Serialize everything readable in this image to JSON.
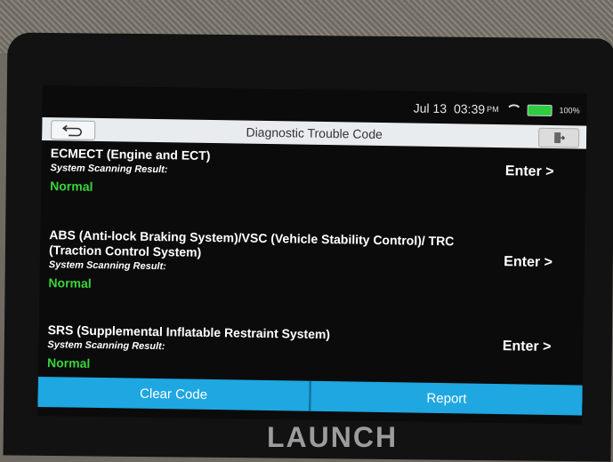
{
  "status": {
    "date": "Jul 13",
    "time": "03:39",
    "ampm": "PM",
    "battery": "100%"
  },
  "titlebar": {
    "title": "Diagnostic Trouble Code"
  },
  "systems": [
    {
      "name": "ECMECT (Engine and ECT)",
      "label": "System Scanning Result:",
      "result": "Normal",
      "enter": "Enter >"
    },
    {
      "name": "ABS (Anti-lock Braking System)/VSC (Vehicle Stability Control)/ TRC (Traction Control System)",
      "label": "System Scanning Result:",
      "result": "Normal",
      "enter": "Enter >"
    },
    {
      "name": "SRS (Supplemental Inflatable Restraint System)",
      "label": "System Scanning Result:",
      "result": "Normal",
      "enter": "Enter >"
    }
  ],
  "actions": {
    "clear": "Clear Code",
    "report": "Report"
  },
  "brand": "LAUNCH",
  "colors": {
    "accent": "#1ea7e1",
    "normal": "#3ad33a"
  },
  "icons": {
    "back": "back-arrow-icon",
    "exit": "exit-icon",
    "wifi": "wifi-icon",
    "battery": "battery-icon"
  }
}
